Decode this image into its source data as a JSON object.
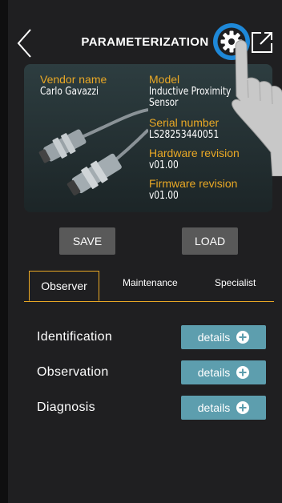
{
  "header": {
    "title": "PARAMETERIZATION",
    "back_icon": "chevron-left-icon",
    "settings_icon": "gear-icon",
    "export_icon": "external-link-icon"
  },
  "device": {
    "vendor_label": "Vendor name",
    "vendor_value": "Carlo Gavazzi",
    "model_label": "Model",
    "model_value_line1": "Inductive Proximity",
    "model_value_line2": "Sensor",
    "serial_label": "Serial number",
    "serial_value": "LS28253440051",
    "hw_label": "Hardware revision",
    "hw_value": "v01.00",
    "fw_label": "Firmware revision",
    "fw_value": "v01.00"
  },
  "actions": {
    "save": "SAVE",
    "load": "LOAD"
  },
  "tabs": [
    {
      "label": "Observer",
      "active": true
    },
    {
      "label": "Maintenance",
      "active": false
    },
    {
      "label": "Specialist",
      "active": false
    }
  ],
  "sections": [
    {
      "label": "Identification",
      "button": "details"
    },
    {
      "label": "Observation",
      "button": "details"
    },
    {
      "label": "Diagnosis",
      "button": "details"
    }
  ],
  "colors": {
    "accent": "#e9a825",
    "details_button": "#5d9eae",
    "action_button": "#595959",
    "highlight_ring": "#1e88d8"
  }
}
